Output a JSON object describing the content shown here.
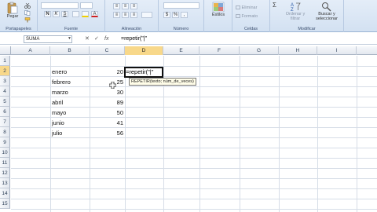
{
  "ribbon": {
    "paste_label": "Pegar",
    "groups": {
      "clipboard": "Portapapeles",
      "font": "Fuente",
      "alignment": "Alineación",
      "number": "Número",
      "cells": "Celdas",
      "modify": "Modificar"
    },
    "styles_label": "Estilos",
    "delete_label": "Eliminar",
    "format_label": "Formato",
    "sort_label": "Ordenar y filtrar",
    "find_label": "Buscar y seleccionar",
    "bold": "N",
    "italic": "K",
    "underline": "S",
    "sigma": "Σ",
    "accent_color": "#2a5aa8"
  },
  "formula_bar": {
    "name_box": "SUMA",
    "cancel": "✕",
    "enter": "✓",
    "fx": "fx",
    "content": "=repetir(\"|\""
  },
  "columns": [
    "A",
    "B",
    "C",
    "D",
    "E",
    "F",
    "G",
    "H",
    "I"
  ],
  "rows": [
    "1",
    "2",
    "3",
    "4",
    "5",
    "6",
    "7",
    "8",
    "9",
    "10",
    "11",
    "12",
    "13",
    "14",
    "15"
  ],
  "months": [
    "enero",
    "febrero",
    "marzo",
    "abril",
    "mayo",
    "junio",
    "julio"
  ],
  "values": [
    "20",
    "25",
    "30",
    "89",
    "50",
    "41",
    "56"
  ],
  "active_cell": {
    "column": "D",
    "row": "2",
    "edit_text": "=repetir(\"|\"",
    "tooltip": "REPETIR(texto; núm_de_veces)"
  }
}
